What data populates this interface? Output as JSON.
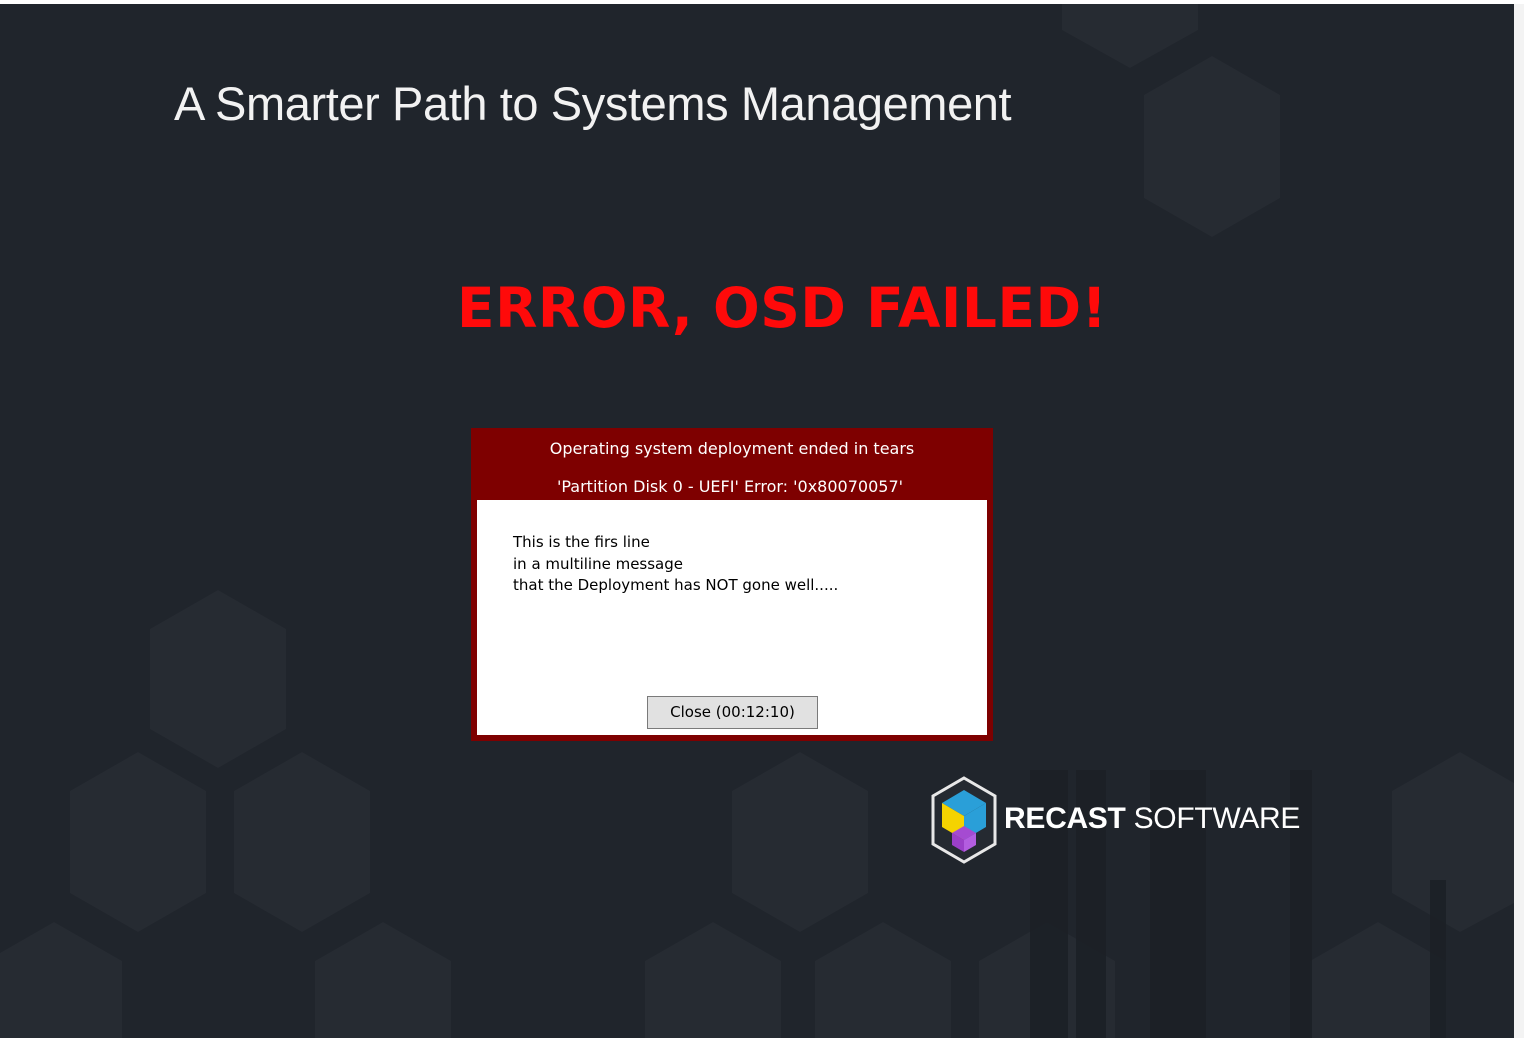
{
  "background": {
    "color": "#20252c",
    "pattern": "hexagon-pattern"
  },
  "headline": "A Smarter Path to Systems Management",
  "error_title": {
    "text": "ERROR, OSD FAILED!",
    "color": "#ff0a0a"
  },
  "dialog": {
    "header_color": "#7e0000",
    "title": "Operating system deployment ended in tears",
    "error_line": "'Partition Disk 0 - UEFI' Error: '0x80070057'",
    "message_lines": [
      "This is the firs line",
      "in a multiline message",
      "that the Deployment has NOT gone well....."
    ],
    "close_button_label": "Close (00:12:10)"
  },
  "brand": {
    "logo_icon": "recast-logo-icon",
    "name_bold": "RECAST",
    "name_light": "SOFTWARE"
  }
}
